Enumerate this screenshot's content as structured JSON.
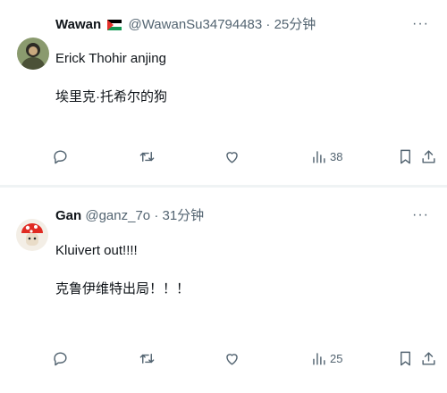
{
  "tweets": [
    {
      "name": "Wawan",
      "handle": "@WawanSu34794483",
      "time": "25分钟",
      "lines": [
        "Erick Thohir anjing",
        "埃里克·托希尔的狗"
      ],
      "views": "38",
      "more_label": "···"
    },
    {
      "name": "Gan",
      "handle": "@ganz_7o",
      "time": "31分钟",
      "lines": [
        "Kluivert out!!!!",
        "克鲁伊维特出局！！！"
      ],
      "views": "25",
      "more_label": "···"
    }
  ],
  "separator": "·",
  "colors": {
    "text": "#0f1419",
    "muted": "#536471",
    "divider": "#eff3f4",
    "background": "#ffffff"
  },
  "icons": [
    "reply-icon",
    "retweet-icon",
    "like-icon",
    "views-icon",
    "bookmark-icon",
    "share-icon",
    "palestine-flag-icon"
  ]
}
